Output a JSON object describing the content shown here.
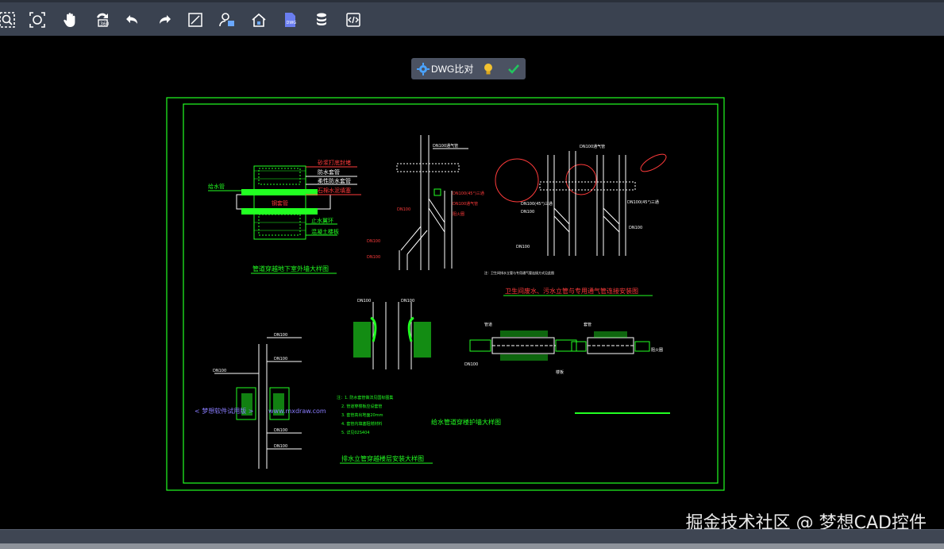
{
  "toolbar": {
    "buttons": [
      {
        "name": "zoom-window-button",
        "icon": "zoom-window-icon"
      },
      {
        "name": "zoom-extents-button",
        "icon": "zoom-extents-icon"
      },
      {
        "name": "pan-button",
        "icon": "hand-icon"
      },
      {
        "name": "regen-button",
        "icon": "refresh-icon"
      },
      {
        "name": "undo-button",
        "icon": "undo-icon"
      },
      {
        "name": "redo-button",
        "icon": "redo-icon"
      },
      {
        "name": "line-button",
        "icon": "line-icon"
      },
      {
        "name": "user-button",
        "icon": "user-icon"
      },
      {
        "name": "home-button",
        "icon": "home-icon"
      },
      {
        "name": "dwg-file-button",
        "icon": "dwg-file-icon"
      },
      {
        "name": "layers-button",
        "icon": "database-icon"
      },
      {
        "name": "code-button",
        "icon": "code-icon"
      }
    ]
  },
  "compare_panel": {
    "label": "DWG比对",
    "colors": {
      "gear": "#4aa3ff",
      "bulb": "#f2c230",
      "check": "#22c55e"
    }
  },
  "drawing": {
    "titles": {
      "t1": "管道穿越地下室外墙大样图",
      "t2": "卫生间废水、污水立管与专用通气管连接安装图",
      "t3": "排水立管穿越楼层安装大样图",
      "t4": "给水管道穿楼护墙大样图"
    },
    "trial_notice": "< 梦想软件试用版 >",
    "site": "www.mxdraw.com",
    "labels": {
      "l1": "砂浆打底封堵",
      "l2": "防水套管",
      "l3": "石棉水泥填塞",
      "l4": "柔性防水套管",
      "l5": "给水管",
      "l6": "DN100(45°)三通",
      "l7": "DN100(45°)三通",
      "l8": "DN100(45°)三通",
      "l9": "DN100通气管",
      "l10": "DN100通气管",
      "l11": "阻火圈",
      "l12": "止水翼环",
      "l13": "钢套管",
      "l14": "混凝土楼板",
      "l15": "注：1. 防水套管做法见国标图集",
      "l16": "2. 管道穿楼板应设套管",
      "l17": "3. 套管高出地面20mm",
      "l18": "4. 套管内填塞阻燃材料",
      "l19": "5. 详见02S404",
      "l20": "DN100",
      "l21": "管道",
      "l22": "楼板",
      "l23": "套管",
      "l24": "阻火圈"
    }
  },
  "watermark": "掘金技术社区 @ 梦想CAD控件"
}
